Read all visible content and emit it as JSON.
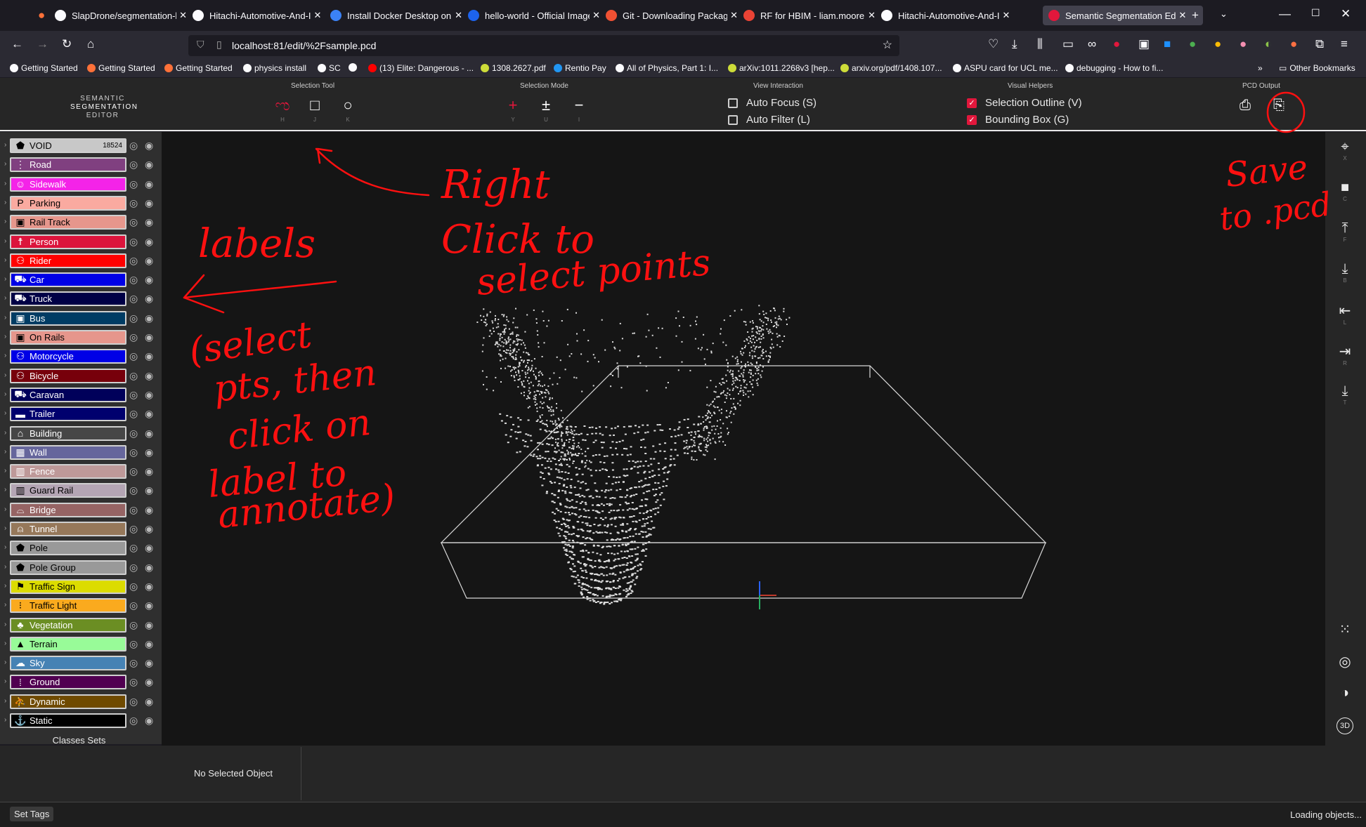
{
  "browser": {
    "tabs": [
      {
        "label": "SlapDrone/segmentation-l",
        "color": "#fbfbfe"
      },
      {
        "label": "Hitachi-Automotive-And-I",
        "color": "#fbfbfe"
      },
      {
        "label": "Install Docker Desktop on W",
        "color": "#3b82f6"
      },
      {
        "label": "hello-world - Official Image",
        "color": "#1d63ed"
      },
      {
        "label": "Git - Downloading Package",
        "color": "#f05133"
      },
      {
        "label": "RF for HBIM - liam.moore@",
        "color": "#ea4335"
      },
      {
        "label": "Hitachi-Automotive-And-I",
        "color": "#fbfbfe"
      },
      {
        "label": "Semantic Segmentation Ed",
        "color": "#e2173c"
      }
    ],
    "url": "localhost:81/edit/%2Fsample.pcd",
    "bookmarks": [
      "Getting Started",
      "Getting Started",
      "Getting Started",
      "physics install",
      "SC",
      "",
      "(13) Elite: Dangerous - ...",
      "1308.2627.pdf",
      "Rentio Pay",
      "All of Physics, Part 1: I...",
      "arXiv:1011.2268v3 [hep...",
      "arxiv.org/pdf/1408.107...",
      "ASPU card for UCL me...",
      "debugging - How to fi..."
    ],
    "other_bookmarks": "Other Bookmarks"
  },
  "app": {
    "logo": [
      "SEMANTIC",
      "SEGMENTATION",
      "EDITOR"
    ],
    "groups": {
      "selection_tool": "Selection Tool",
      "selection_mode": "Selection Mode",
      "view_interaction": "View Interaction",
      "visual_helpers": "Visual Helpers",
      "pcd_output": "PCD Output"
    },
    "selection_tools": [
      {
        "name": "lasso-icon",
        "glyph": "ಌ",
        "key": "H",
        "color": "#e2173c"
      },
      {
        "name": "rectangle-icon",
        "glyph": "□",
        "key": "J",
        "color": "#ffffff"
      },
      {
        "name": "circle-icon",
        "glyph": "○",
        "key": "K",
        "color": "#ffffff"
      }
    ],
    "selection_modes": [
      {
        "name": "add-mode-icon",
        "glyph": "+",
        "key": "Y",
        "color": "#e2173c"
      },
      {
        "name": "plus-minus-icon",
        "glyph": "±",
        "key": "U",
        "color": "#ffffff"
      },
      {
        "name": "minus-icon",
        "glyph": "−",
        "key": "I",
        "color": "#ffffff"
      }
    ],
    "view_interaction": [
      {
        "label": "Auto Focus (S)",
        "checked": false
      },
      {
        "label": "Auto Filter (L)",
        "checked": false
      }
    ],
    "visual_helpers": [
      {
        "label": "Selection Outline (V)",
        "checked": true
      },
      {
        "label": "Bounding Box (G)",
        "checked": true
      }
    ]
  },
  "labels": [
    {
      "name": "VOID",
      "color": "#c8c8c8",
      "text": "#000000",
      "icon": "⬟",
      "count": "18524"
    },
    {
      "name": "Road",
      "color": "#804080",
      "text": "#ffffff",
      "icon": "⋮"
    },
    {
      "name": "Sidewalk",
      "color": "#f423e8",
      "text": "#ffffff",
      "icon": "☺"
    },
    {
      "name": "Parking",
      "color": "#faaaa0",
      "text": "#000000",
      "icon": "P"
    },
    {
      "name": "Rail Track",
      "color": "#e6968c",
      "text": "#000000",
      "icon": "▣"
    },
    {
      "name": "Person",
      "color": "#dc143c",
      "text": "#ffffff",
      "icon": "☨"
    },
    {
      "name": "Rider",
      "color": "#ff0000",
      "text": "#ffffff",
      "icon": "⚇"
    },
    {
      "name": "Car",
      "color": "#0000e6",
      "text": "#ffffff",
      "icon": "⛟"
    },
    {
      "name": "Truck",
      "color": "#000046",
      "text": "#ffffff",
      "icon": "⛟"
    },
    {
      "name": "Bus",
      "color": "#003c64",
      "text": "#ffffff",
      "icon": "▣"
    },
    {
      "name": "On Rails",
      "color": "#e6968c",
      "text": "#000000",
      "icon": "▣"
    },
    {
      "name": "Motorcycle",
      "color": "#0000e6",
      "text": "#ffffff",
      "icon": "⚇"
    },
    {
      "name": "Bicycle",
      "color": "#77000b",
      "text": "#ffffff",
      "icon": "⚇"
    },
    {
      "name": "Caravan",
      "color": "#00005a",
      "text": "#ffffff",
      "icon": "⛟"
    },
    {
      "name": "Trailer",
      "color": "#00006e",
      "text": "#ffffff",
      "icon": "▬"
    },
    {
      "name": "Building",
      "color": "#464646",
      "text": "#ffffff",
      "icon": "⌂"
    },
    {
      "name": "Wall",
      "color": "#66669c",
      "text": "#ffffff",
      "icon": "▦"
    },
    {
      "name": "Fence",
      "color": "#be9999",
      "text": "#ffffff",
      "icon": "▥"
    },
    {
      "name": "Guard Rail",
      "color": "#b4a5b4",
      "text": "#000000",
      "icon": "▥"
    },
    {
      "name": "Bridge",
      "color": "#966464",
      "text": "#ffffff",
      "icon": "⌓"
    },
    {
      "name": "Tunnel",
      "color": "#96785a",
      "text": "#ffffff",
      "icon": "⍝"
    },
    {
      "name": "Pole",
      "color": "#999999",
      "text": "#000000",
      "icon": "⬟"
    },
    {
      "name": "Pole Group",
      "color": "#999999",
      "text": "#000000",
      "icon": "⬟"
    },
    {
      "name": "Traffic Sign",
      "color": "#dcdc00",
      "text": "#000000",
      "icon": "⚑"
    },
    {
      "name": "Traffic Light",
      "color": "#faaa1e",
      "text": "#000000",
      "icon": "⁝"
    },
    {
      "name": "Vegetation",
      "color": "#6b8e23",
      "text": "#ffffff",
      "icon": "♣"
    },
    {
      "name": "Terrain",
      "color": "#98fb98",
      "text": "#000000",
      "icon": "▲"
    },
    {
      "name": "Sky",
      "color": "#4682b4",
      "text": "#ffffff",
      "icon": "☁"
    },
    {
      "name": "Ground",
      "color": "#510051",
      "text": "#ffffff",
      "icon": "⁞"
    },
    {
      "name": "Dynamic",
      "color": "#6f4a00",
      "text": "#ffffff",
      "icon": "⛹"
    },
    {
      "name": "Static",
      "color": "#000000",
      "text": "#ffffff",
      "icon": "⚓"
    }
  ],
  "classes_sets": "Classes Sets",
  "right_toolbar": [
    {
      "name": "crosshair-icon",
      "glyph": "⌖",
      "key": "X"
    },
    {
      "name": "camera-icon",
      "glyph": "■",
      "key": "C"
    },
    {
      "name": "front-view-icon",
      "glyph": "⤒",
      "key": "F"
    },
    {
      "name": "back-view-icon",
      "glyph": "⤓",
      "key": "B"
    },
    {
      "name": "left-view-icon",
      "glyph": "⇤",
      "key": "L"
    },
    {
      "name": "right-view-icon",
      "glyph": "⇥",
      "key": "R"
    },
    {
      "name": "top-view-icon",
      "glyph": "⤓",
      "key": "T"
    }
  ],
  "right_bottom_tools": [
    {
      "name": "grid-dots-icon",
      "glyph": "⁙"
    },
    {
      "name": "target-icon",
      "glyph": "◎"
    },
    {
      "name": "brightness-icon",
      "glyph": "◑"
    },
    {
      "name": "3d-rotate-icon",
      "glyph": "3D"
    }
  ],
  "bottom": {
    "no_selected": "No Selected Object",
    "set_tags": "Set Tags",
    "loading": "Loading objects..."
  },
  "annotations": {
    "right_click": [
      "Right",
      "Click to",
      "select points"
    ],
    "labels": "labels",
    "select_note": [
      "(select",
      "pts, then",
      "click on",
      "label to",
      "annotate)"
    ],
    "save": [
      "Save",
      "to .pcd"
    ]
  }
}
